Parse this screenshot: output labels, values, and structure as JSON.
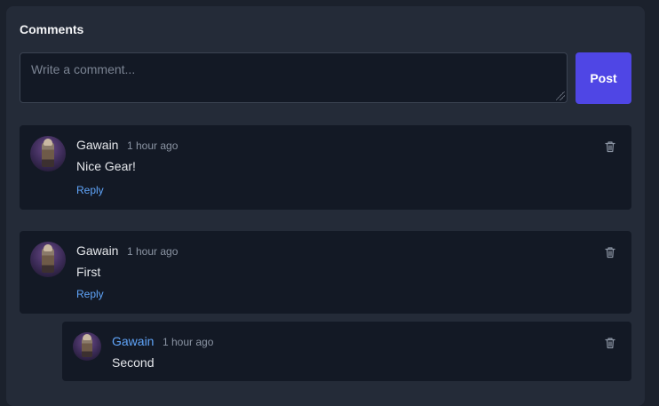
{
  "comments_section": {
    "title": "Comments",
    "composer": {
      "placeholder": "Write a comment...",
      "value": ""
    },
    "post_label": "Post"
  },
  "comments": [
    {
      "author": "Gawain",
      "time": "1 hour ago",
      "text": "Nice Gear!",
      "reply_label": "Reply",
      "icons": {
        "avatar": "knight-avatar",
        "delete": "trash-icon"
      }
    },
    {
      "author": "Gawain",
      "time": "1 hour ago",
      "text": "First",
      "reply_label": "Reply",
      "icons": {
        "avatar": "knight-avatar",
        "delete": "trash-icon"
      }
    },
    {
      "author": "Gawain",
      "time": "1 hour ago",
      "text": "Second",
      "is_reply": true,
      "icons": {
        "avatar": "knight-avatar",
        "delete": "trash-icon"
      }
    }
  ],
  "colors": {
    "accent": "#4f46e5",
    "link": "#60a5fa",
    "card": "#131925",
    "panel": "#242b38"
  }
}
